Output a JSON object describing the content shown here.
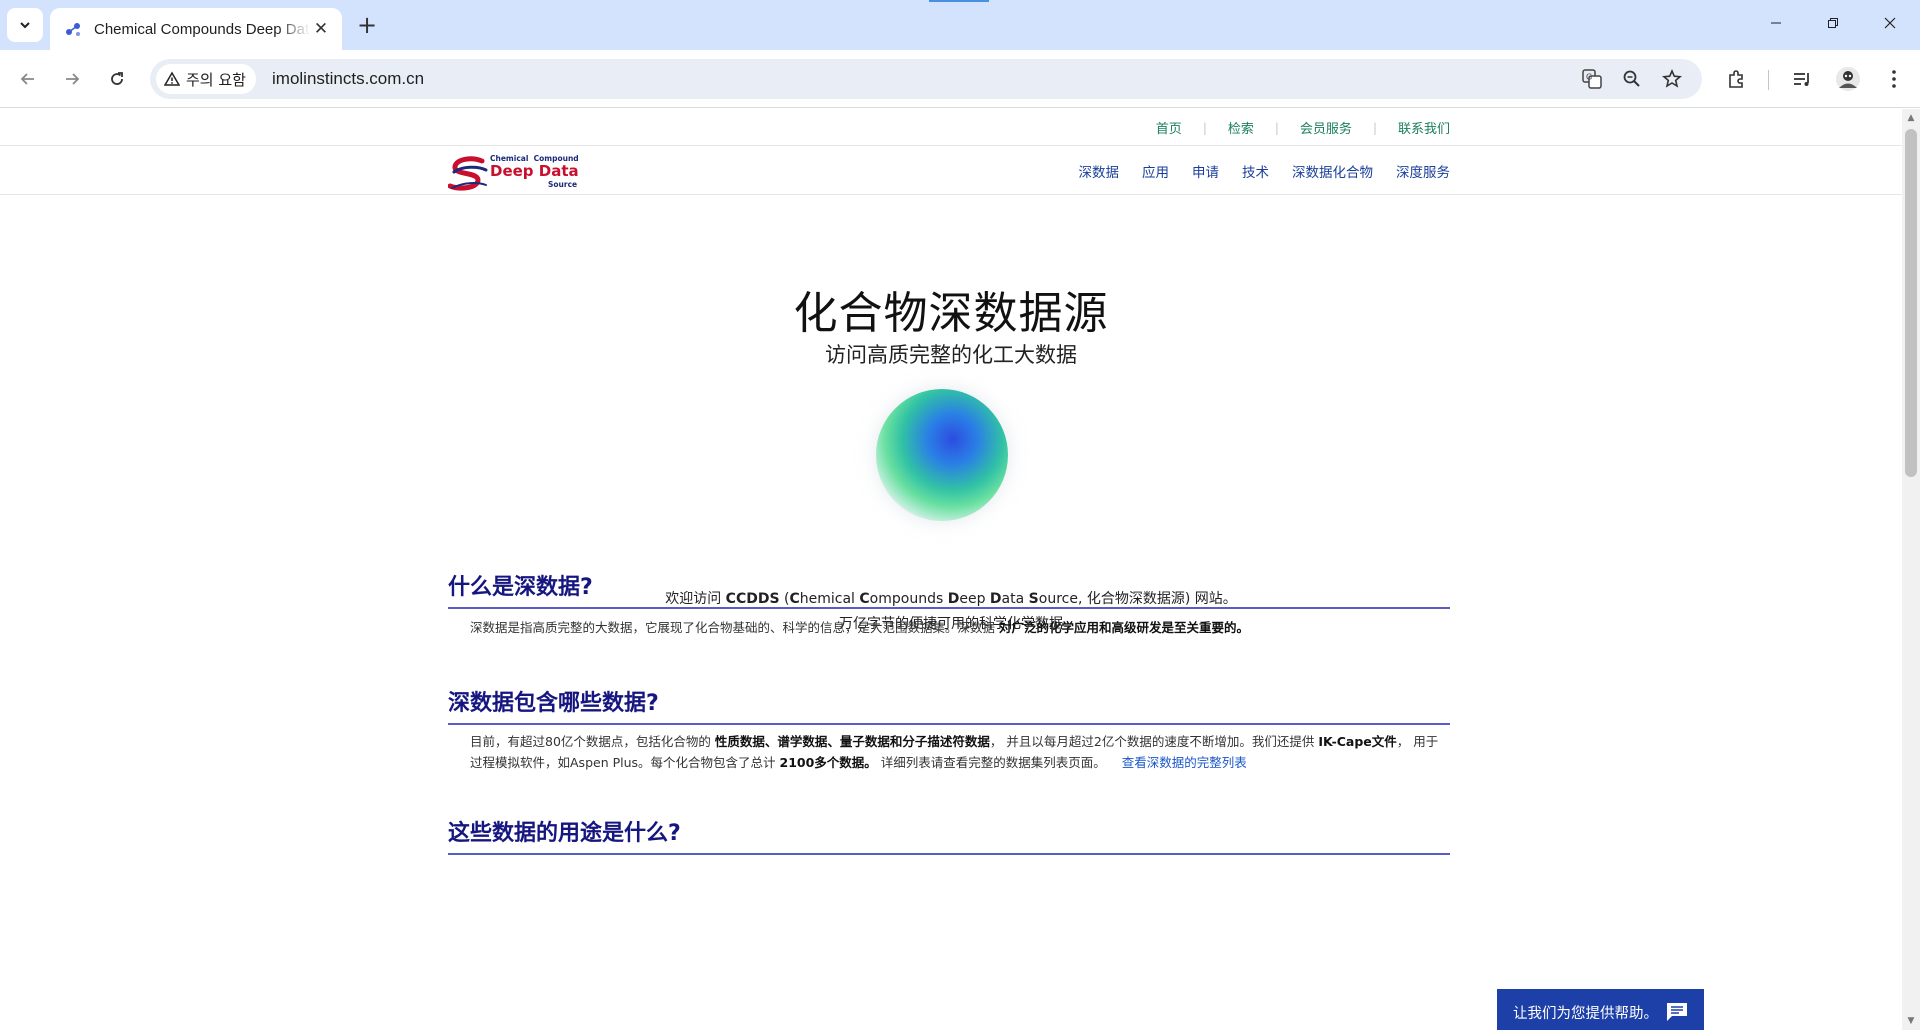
{
  "browser": {
    "tab_title": "Chemical Compounds Deep Data Source",
    "new_tab_label": "+",
    "close_tab_label": "✕",
    "security_label": "주의 요함",
    "url": "imolinstincts.com.cn",
    "window_controls": {
      "minimize": "—",
      "restore": "❐",
      "close": "✕"
    }
  },
  "page": {
    "top_links": [
      "首页",
      "检索",
      "会员服务",
      "联系我们"
    ],
    "logo": {
      "line1": "Chemical  Compound",
      "line2": "Deep Data",
      "line3": "Source"
    },
    "nav": [
      "深数据",
      "应用",
      "申请",
      "技术",
      "深数据化合物",
      "深度服务"
    ],
    "hero": {
      "title": "化合物深数据源",
      "subtitle": "访问高质完整的化工大数据"
    },
    "welcome": {
      "pre": "欢迎访问 ",
      "ccdds": "CCDDS",
      "open": " (",
      "c1": "C",
      "hemical": "hemical ",
      "c2": "C",
      "ompounds": "ompounds ",
      "d": "D",
      "eep": "eep ",
      "d2": "D",
      "ata": "ata ",
      "s": "S",
      "ource": "ource, 化合物深数据源) 网站。",
      "line2": "万亿字节的便捷可用的科学化学数据"
    },
    "sections": [
      {
        "heading": "什么是深数据?",
        "text1": "深数据是指高质完整的大数据，它展现了化合物基础的、科学的信息，是大范围数据集。深数据 ",
        "bold1": "对广泛的化学应用和高级研发是至关重要的。"
      },
      {
        "heading": "深数据包含哪些数据?",
        "text1": "目前，有超过80亿个数据点，包括化合物的 ",
        "bold1": "性质数据、谱学数据、量子数据和分子描述符数据",
        "text2": "， 并且以每月超过2亿个数据的速度不断增加。我们还提供 ",
        "bold2": "IK-Cape文件",
        "text3": "， 用于过程模拟软件，如Aspen Plus。每个化合物包含了总计 ",
        "bold3": "2100多个数据。",
        "text4": " 详细列表请查看完整的数据集列表页面。",
        "link": "查看深数据的完整列表"
      },
      {
        "heading": "这些数据的用途是什么?"
      }
    ],
    "help_widget": "让我们为您提供帮助。"
  },
  "colors": {
    "tab_strip": "#d3e3fd",
    "omnibox": "#e9eef6",
    "top_link": "#1a7f5a",
    "nav_link": "#1a3f9a",
    "section_heading": "#161680",
    "help_widget_bg": "#1d3fa8",
    "logo_red": "#c8102e",
    "logo_navy": "#1b2a7a"
  },
  "icons": [
    "tab-search-icon",
    "favicon-icon",
    "back-icon",
    "forward-icon",
    "reload-icon",
    "warning-icon",
    "translate-icon",
    "zoom-icon",
    "bookmark-star-icon",
    "extensions-icon",
    "media-queue-icon",
    "profile-avatar-icon",
    "more-menu-icon",
    "chat-icon"
  ]
}
